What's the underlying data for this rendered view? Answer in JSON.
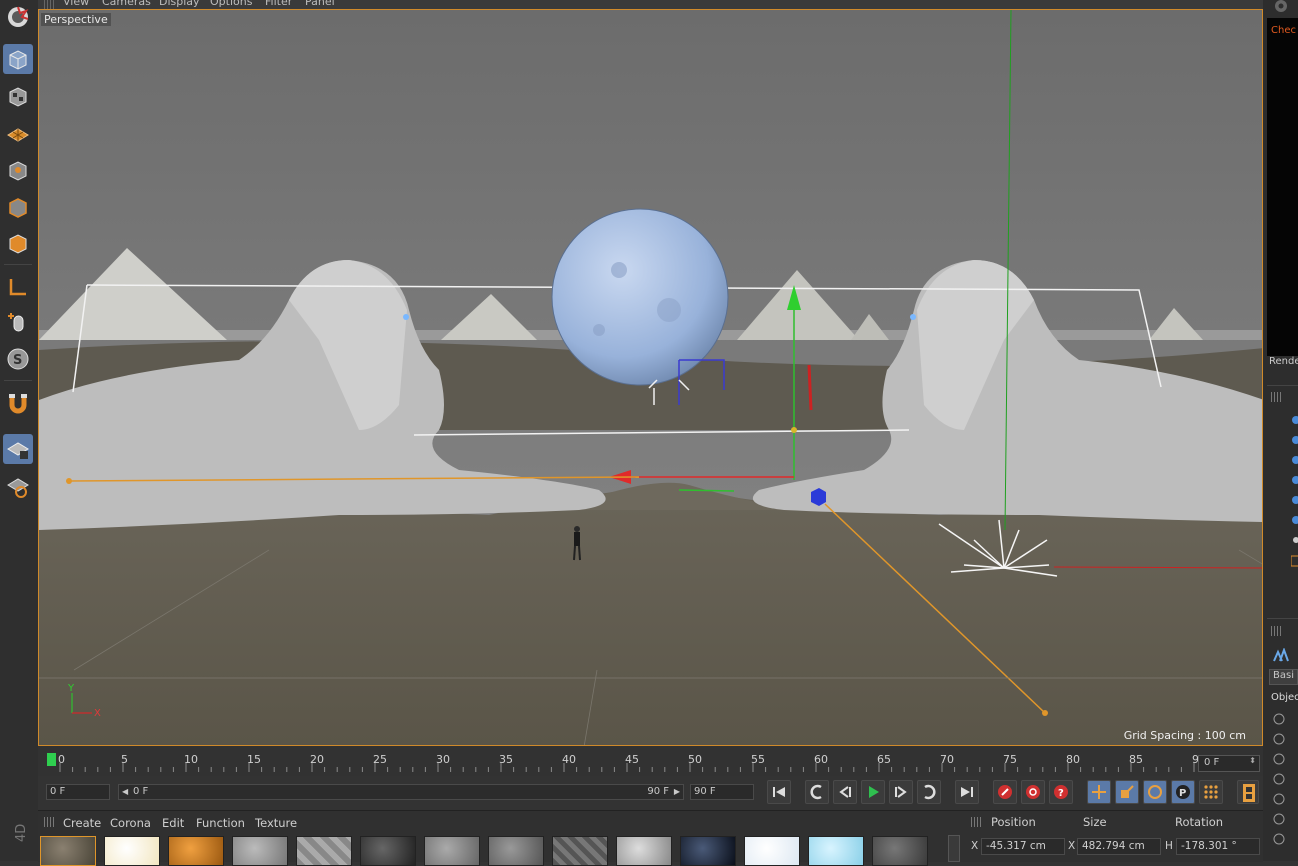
{
  "menubar": {
    "items": [
      "View",
      "Cameras",
      "Display",
      "Options",
      "Filter",
      "Panel"
    ]
  },
  "viewport": {
    "label": "Perspective",
    "grid_spacing": "Grid Spacing : 100 cm",
    "axis_x": "X",
    "axis_y": "Y"
  },
  "right_panel": {
    "render_text": "Chec",
    "render_label": "Rende",
    "basic_tab": "Basi",
    "object_tab": "Objec"
  },
  "timeline": {
    "ticks": [
      "0",
      "5",
      "10",
      "15",
      "20",
      "25",
      "30",
      "35",
      "40",
      "45",
      "50",
      "55",
      "60",
      "65",
      "70",
      "75",
      "80",
      "85",
      "90"
    ],
    "current_frame": "0 F"
  },
  "transport": {
    "start_field": "0 F",
    "range_start": "0 F",
    "range_end": "90 F",
    "end_field": "90 F"
  },
  "material_manager": {
    "menu": [
      "Create",
      "Corona",
      "Edit",
      "Function",
      "Texture"
    ],
    "corner_label": "4D"
  },
  "coordinates": {
    "headers": [
      "Position",
      "Size",
      "Rotation"
    ],
    "row": {
      "pos_axis": "X",
      "pos_value": "-45.317 cm",
      "size_axis": "X",
      "size_value": "482.794 cm",
      "rot_axis": "H",
      "rot_value": "-178.301 °"
    }
  },
  "colors": {
    "accent": "#5b7aa8",
    "viewport_border": "#d08a2a",
    "sphere": "#9db4d8",
    "play_green": "#2fbf4f"
  }
}
